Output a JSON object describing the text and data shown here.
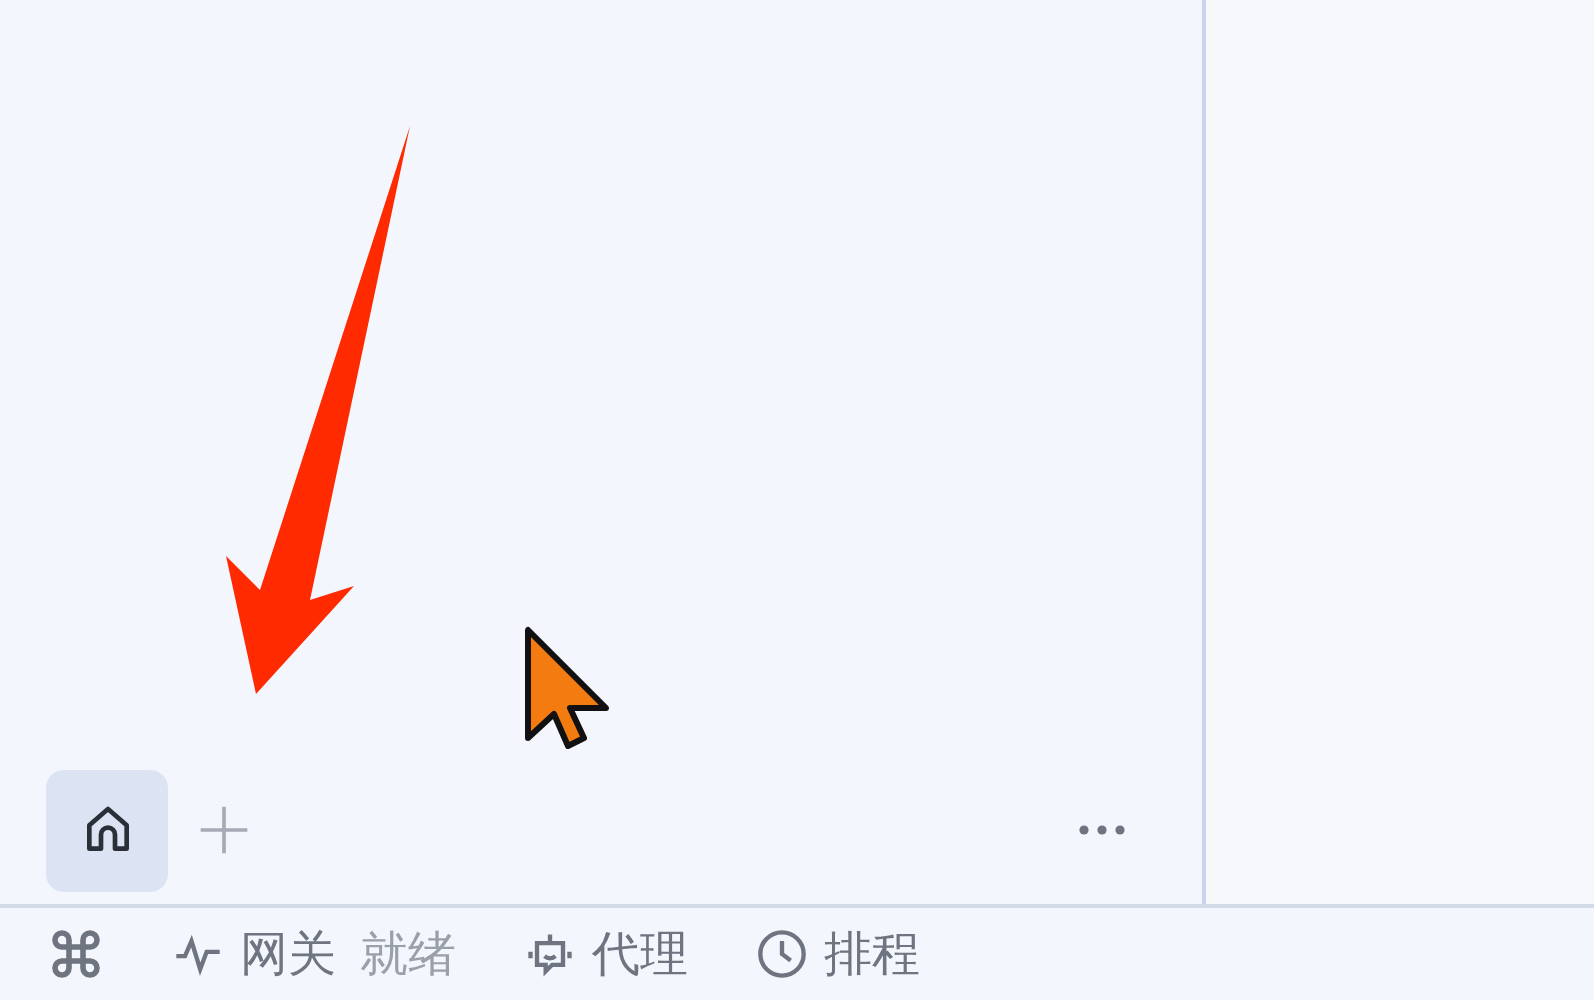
{
  "tabs": [
    {
      "kind": "home",
      "selected": true
    }
  ],
  "status_bar": {
    "items": [
      {
        "kind": "command"
      },
      {
        "kind": "gateway",
        "label": "网关",
        "status": "就绪"
      },
      {
        "kind": "agent",
        "label": "代理"
      },
      {
        "kind": "schedule",
        "label": "排程"
      }
    ]
  }
}
